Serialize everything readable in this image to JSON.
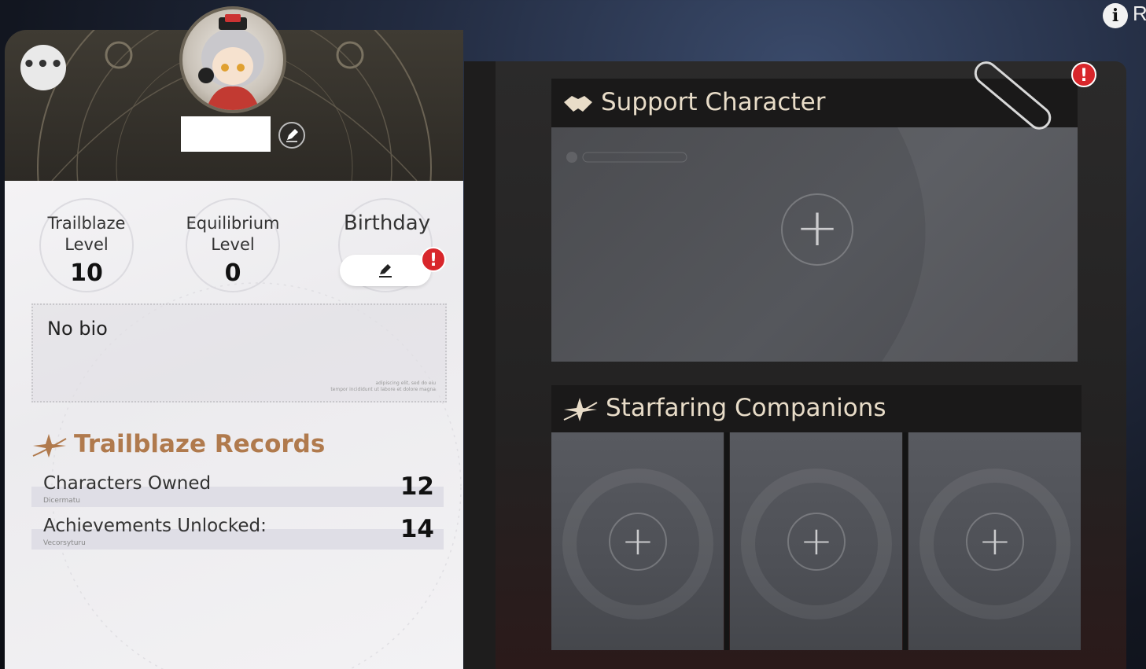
{
  "top_right": {
    "info_label": "i",
    "next_label": "R"
  },
  "profile": {
    "stats": [
      {
        "label": "Trailblaze Level",
        "value": "10"
      },
      {
        "label": "Equilibrium Level",
        "value": "0"
      },
      {
        "label": "Birthday",
        "value": ""
      }
    ],
    "bio": "No bio",
    "bio_fine_print": [
      "adipiscing elit, sed do eiu",
      "tempor incididunt ut labore et dolore magna"
    ],
    "records_title": "Trailblaze Records",
    "records": [
      {
        "label": "Characters Owned",
        "sub": "Dicermatu",
        "value": "12"
      },
      {
        "label": "Achievements Unlocked:",
        "sub": "Vecorsyturu",
        "value": "14"
      }
    ]
  },
  "book": {
    "support_title": "Support Character",
    "companions_title": "Starfaring Companions"
  },
  "colors": {
    "accent": "#b07a4d",
    "alert": "#d8262b",
    "title": "#e8dcc8"
  },
  "icons": [
    "info-icon",
    "more-icon",
    "edit-icon",
    "alert-icon",
    "handshake-icon",
    "sparkle-icon",
    "plus-icon",
    "paperclip-icon"
  ]
}
